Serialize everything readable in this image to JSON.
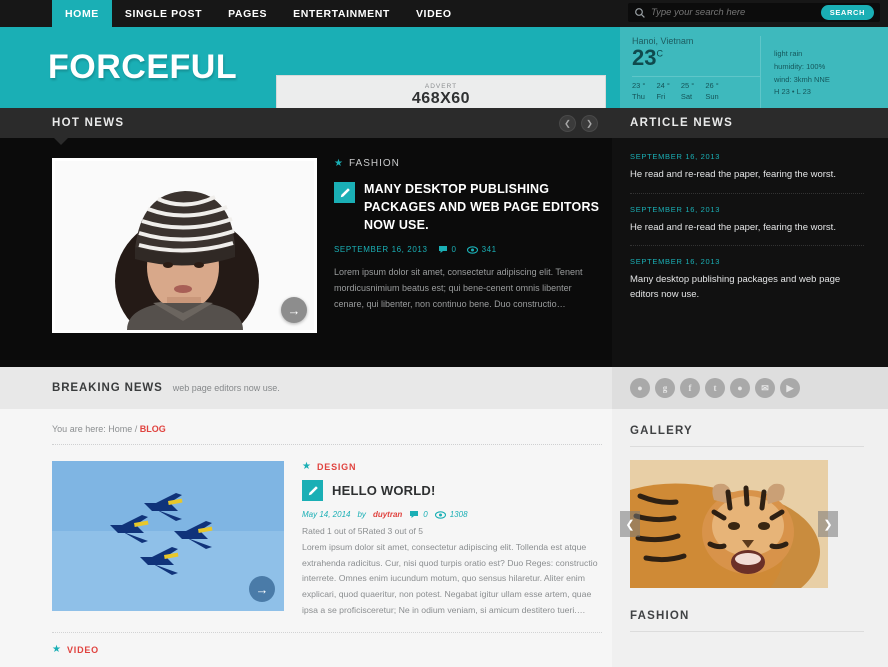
{
  "nav": {
    "items": [
      {
        "label": "HOME",
        "active": true
      },
      {
        "label": "SINGLE POST",
        "active": false
      },
      {
        "label": "PAGES",
        "active": false
      },
      {
        "label": "ENTERTAINMENT",
        "active": false
      },
      {
        "label": "VIDEO",
        "active": false
      }
    ]
  },
  "search": {
    "placeholder": "Type your search here",
    "value": "",
    "button_label": "SEARCH"
  },
  "header": {
    "brand": "FORCEFUL",
    "advert": {
      "label": "ADVERT",
      "size": "468X60"
    }
  },
  "weather": {
    "city": "Hanoi, Vietnam",
    "temp": "23",
    "unit": "C",
    "condition": "light rain",
    "humidity": "humidity: 100%",
    "wind": "wind: 3kmh NNE",
    "highlow": "H 23 • L 23",
    "forecast": [
      {
        "temp": "23 °",
        "day": "Thu"
      },
      {
        "temp": "24 °",
        "day": "Fri"
      },
      {
        "temp": "25 °",
        "day": "Sat"
      },
      {
        "temp": "26 °",
        "day": "Sun"
      }
    ]
  },
  "hotnews": {
    "title": "HOT NEWS",
    "category": "FASHION",
    "headline": "MANY DESKTOP PUBLISHING PACKAGES AND WEB PAGE EDITORS NOW USE.",
    "date": "SEPTEMBER 16, 2013",
    "comments": "0",
    "views": "341",
    "excerpt": "Lorem ipsum dolor sit amet, consectetur adipiscing elit. Tenent mordicusnimium beatus est; qui bene-cenent omnis libenter cenare, qui libenter, non continuo bene. Duo constructio…"
  },
  "articlenews": {
    "title": "ARTICLE NEWS",
    "items": [
      {
        "date": "SEPTEMBER 16, 2013",
        "text": "He read and re-read the paper, fearing the worst."
      },
      {
        "date": "SEPTEMBER 16, 2013",
        "text": "He read and re-read the paper, fearing the worst."
      },
      {
        "date": "SEPTEMBER 16, 2013",
        "text": "Many desktop publishing packages and web page editors now use."
      }
    ]
  },
  "breaking": {
    "label": "BREAKING NEWS",
    "text": "web page editors now use.",
    "social": [
      "behance-icon",
      "googleplus-icon",
      "facebook-icon",
      "twitter-icon",
      "rss-icon",
      "mail-icon",
      "youtube-icon"
    ],
    "social_glyphs": [
      "●",
      "g",
      "f",
      "t",
      "●",
      "✉",
      "▶"
    ]
  },
  "breadcrumb": {
    "prefix": "You are here:",
    "home": "Home",
    "separator": "/",
    "current": "BLOG"
  },
  "post": {
    "category": "DESIGN",
    "title": "HELLO WORLD!",
    "date": "May 14, 2014",
    "by_label": "by",
    "author": "duytran",
    "comments": "0",
    "views": "1308",
    "rating": "Rated 1 out of 5Rated 3 out of 5",
    "excerpt": "Lorem ipsum dolor sit amet, consectetur adipiscing elit. Tollenda est atque extrahenda radicitus. Cur, nisi quod turpis oratio est? Duo Reges: constructio interrete. Omnes enim iucundum motum, quo sensus hilaretur. Aliter enim explicari, quod quaeritur, non potest. Negabat igitur ullam esse artem, quae ipsa a se proficisceretur; Ne in odium veniam, si amicum destitero tueri.…"
  },
  "next_post": {
    "category": "VIDEO"
  },
  "sidebar": {
    "gallery_title": "GALLERY",
    "fashion_title": "FASHION"
  },
  "colors": {
    "accent": "#1aafb5",
    "red": "#e0433f",
    "dark": "#171717"
  }
}
